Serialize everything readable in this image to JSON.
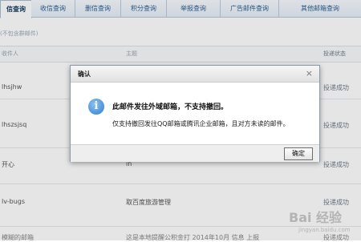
{
  "tabs": [
    {
      "label": "信查询",
      "active": true
    },
    {
      "label": "收信查询",
      "active": false
    },
    {
      "label": "删信查询",
      "active": false
    },
    {
      "label": "积分查询",
      "active": false
    },
    {
      "label": "举报查询",
      "active": false
    },
    {
      "label": "广告邮件查询",
      "active": false
    },
    {
      "label": "其他邮箱查询",
      "active": false
    }
  ],
  "hint": "(不包含群邮件)",
  "table": {
    "headers": {
      "sender": "收件人",
      "subject": "主题",
      "status": "投递状态"
    },
    "rows": [
      {
        "sender": "lhsjhw",
        "subject": "",
        "status": "投递成功"
      },
      {
        "sender": "lhszsjsq",
        "subject": "",
        "status": "投递成功"
      },
      {
        "sender": "开心",
        "subject": "in",
        "status": "投递成功"
      },
      {
        "sender": "lv-bugs",
        "subject": "取百度旅游管理",
        "status": "投递成功"
      },
      {
        "sender": "模糊的邮箱",
        "subject": "这是本地提醒公积金打 2014年10月 信息 上报",
        "status": "投递成功"
      }
    ]
  },
  "dialog": {
    "title": "确认",
    "close_glyph": "×",
    "icon_glyph": "i",
    "message_main": "此邮件发往外域邮箱，不支持撤回。",
    "message_sub": "仅支持撤回发往QQ邮箱或腾讯企业邮箱，且对方未读的邮件。",
    "ok_label": "确定"
  },
  "watermark": {
    "text": "Bai 经验",
    "sub": "jingyan.baidu.com"
  }
}
